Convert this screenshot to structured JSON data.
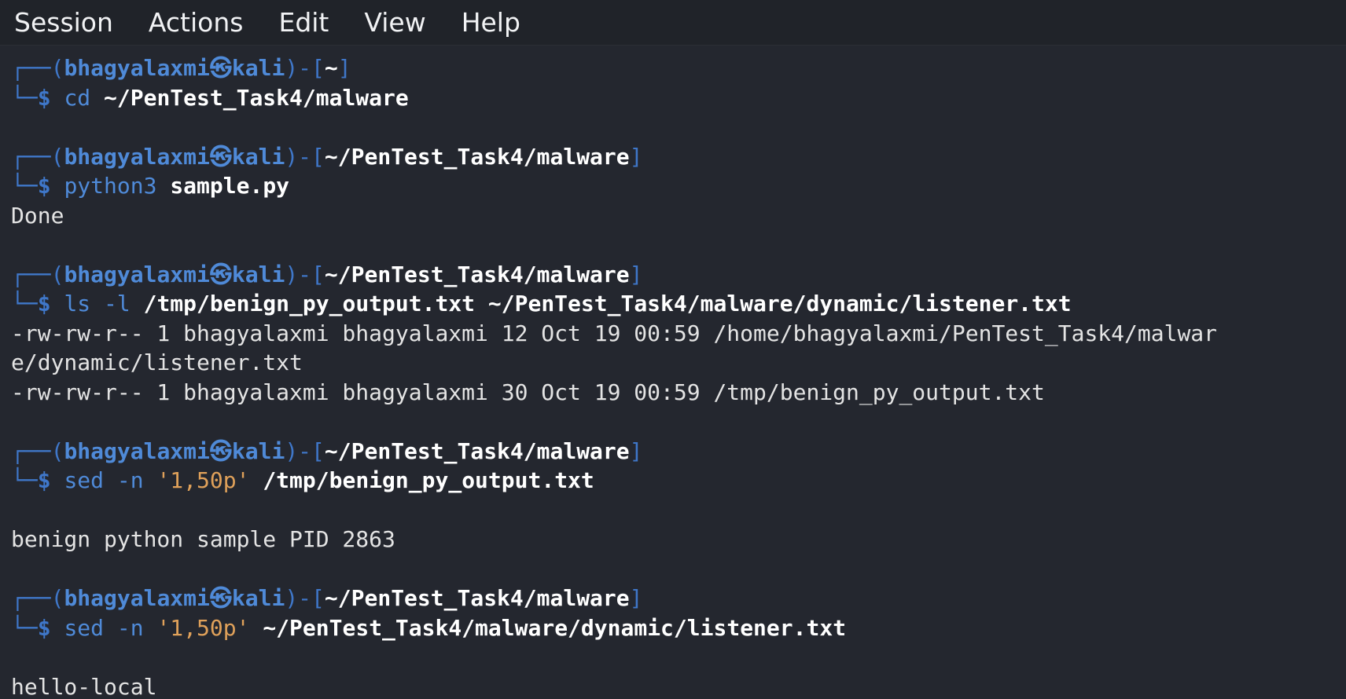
{
  "menubar": {
    "items": [
      "Session",
      "Actions",
      "Edit",
      "View",
      "Help"
    ]
  },
  "prompt": {
    "user": "bhagyalaxmi",
    "at_symbol": "㉿",
    "host": "kali",
    "frame_top_left": "┌──(",
    "frame_mid": ")-[",
    "frame_end": "]",
    "frame_bottom": "└─",
    "symbol": "$"
  },
  "blocks": [
    {
      "dir": "~",
      "cmd": "cd",
      "opts": "",
      "str": "",
      "args": "~/PenTest_Task4/malware",
      "output": []
    },
    {
      "dir": "~/PenTest_Task4/malware",
      "cmd": "python3",
      "opts": "",
      "str": "",
      "args": "sample.py",
      "output": [
        "Done"
      ]
    },
    {
      "dir": "~/PenTest_Task4/malware",
      "cmd": "ls",
      "opts": "-l",
      "str": "",
      "args": "/tmp/benign_py_output.txt ~/PenTest_Task4/malware/dynamic/listener.txt",
      "output": [
        "-rw-rw-r-- 1 bhagyalaxmi bhagyalaxmi 12 Oct 19 00:59 /home/bhagyalaxmi/PenTest_Task4/malwar",
        "e/dynamic/listener.txt",
        "-rw-rw-r-- 1 bhagyalaxmi bhagyalaxmi 30 Oct 19 00:59 /tmp/benign_py_output.txt"
      ]
    },
    {
      "dir": "~/PenTest_Task4/malware",
      "cmd": "sed",
      "opts": "-n",
      "str": "'1,50p'",
      "args": "/tmp/benign_py_output.txt",
      "output": [
        "",
        "benign python sample PID 2863"
      ]
    },
    {
      "dir": "~/PenTest_Task4/malware",
      "cmd": "sed",
      "opts": "-n",
      "str": "'1,50p'",
      "args": "~/PenTest_Task4/malware/dynamic/listener.txt",
      "output": [
        "",
        "hello-local"
      ]
    }
  ],
  "colors": {
    "background": "#24272f",
    "menubar": "#202329",
    "prompt_blue": "#4f8ad8",
    "string_orange": "#e0a15a",
    "text": "#e4e4e4"
  }
}
